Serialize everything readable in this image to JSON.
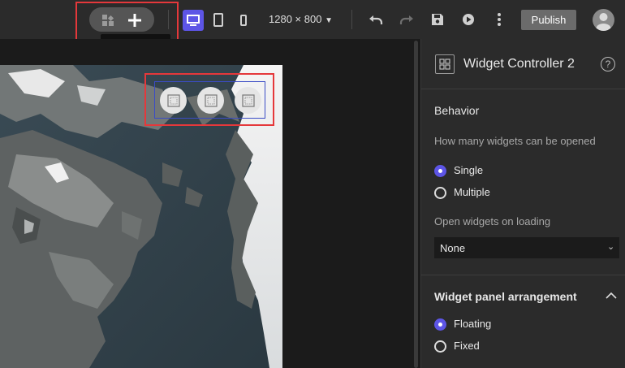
{
  "toolbar": {
    "tooltip": "Add widget",
    "resolution": "1280 × 800",
    "publish_label": "Publish"
  },
  "panel": {
    "title": "Widget Controller 2",
    "behavior": {
      "heading": "Behavior",
      "question": "How many widgets can be opened",
      "options": [
        "Single",
        "Multiple"
      ],
      "selected": "Single"
    },
    "open_on_loading": {
      "label": "Open widgets on loading",
      "value": "None"
    },
    "arrangement": {
      "heading": "Widget panel arrangement",
      "options": [
        "Floating",
        "Fixed"
      ],
      "selected": "Floating"
    }
  },
  "colors": {
    "accent": "#5d55e6",
    "highlight": "#e5383b",
    "selection_border": "#3b4cc5"
  }
}
